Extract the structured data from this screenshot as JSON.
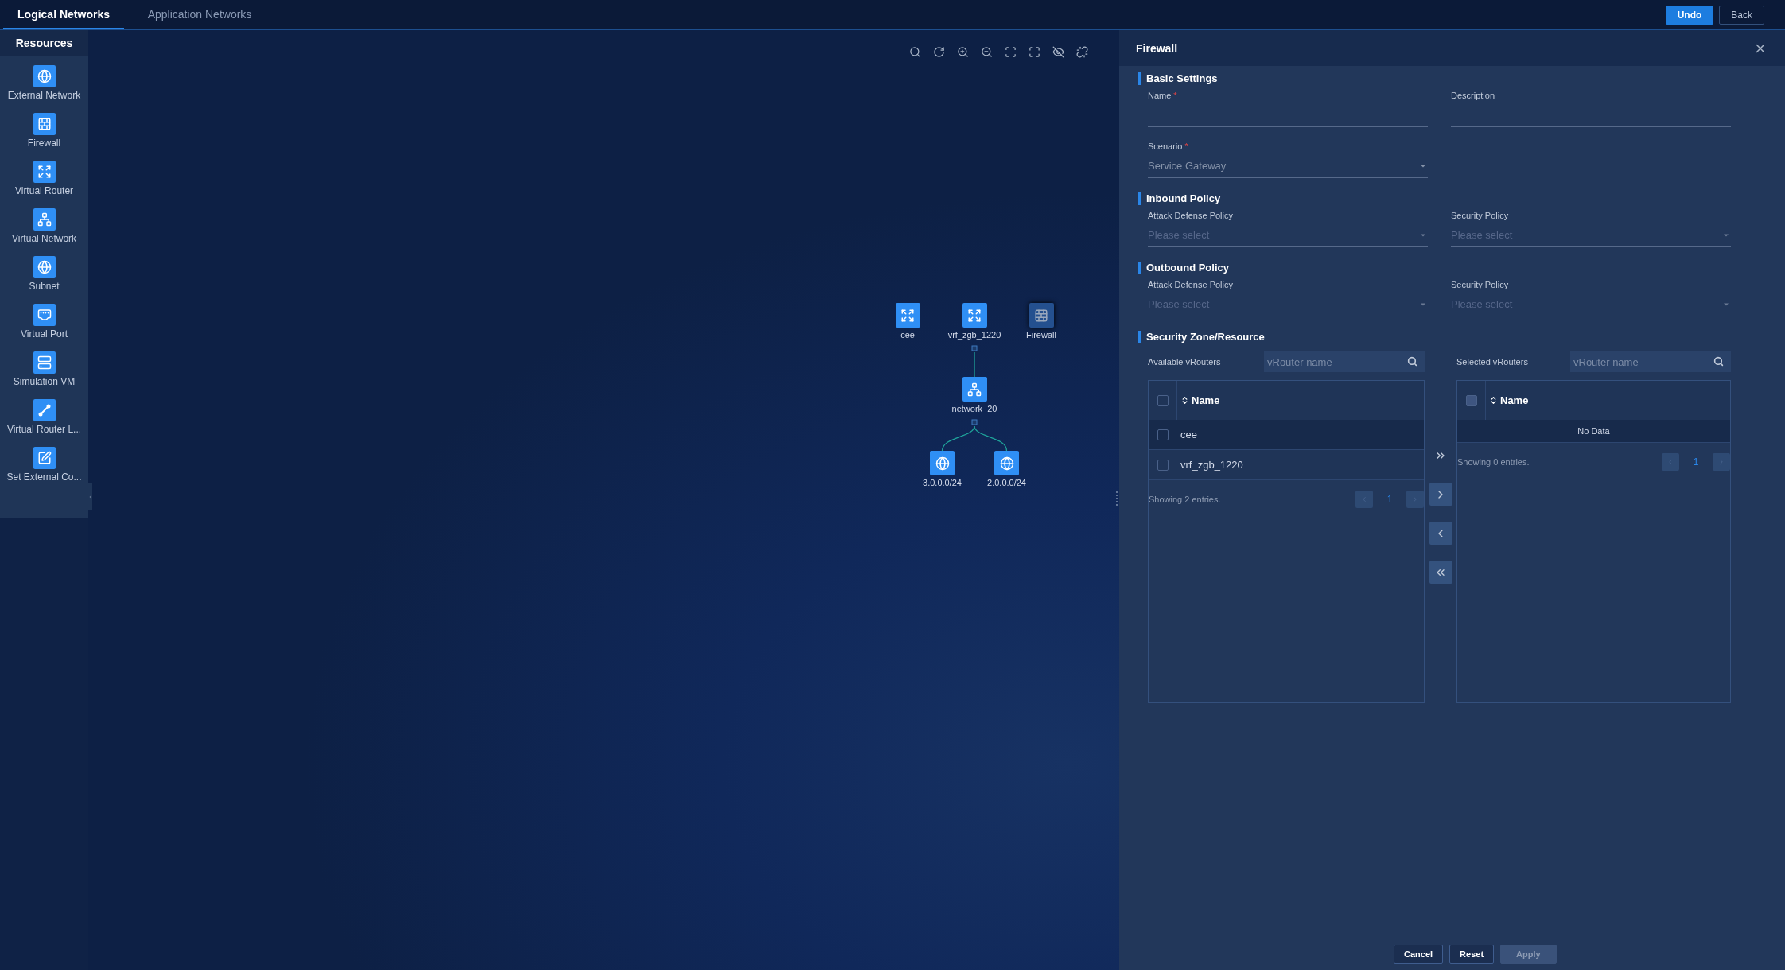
{
  "top_tabs": [
    {
      "label": "Logical Networks",
      "selected": true
    },
    {
      "label": "Application Networks",
      "selected": false
    }
  ],
  "top_actions": [
    {
      "label": "Undo",
      "kind": "primary"
    },
    {
      "label": "Back",
      "kind": "secondary"
    }
  ],
  "sidebar": {
    "title": "Resources",
    "items": [
      {
        "label": "External Network",
        "kind": "external"
      },
      {
        "label": "Firewall",
        "kind": "firewall"
      },
      {
        "label": "Virtual Router",
        "kind": "router"
      },
      {
        "label": "Virtual Network",
        "kind": "network"
      },
      {
        "label": "Subnet",
        "kind": "subnet"
      },
      {
        "label": "Virtual Port",
        "kind": "port"
      },
      {
        "label": "Simulation VM",
        "kind": "vm"
      },
      {
        "label": "Virtual Router L...",
        "kind": "link"
      },
      {
        "label": "Set External Co...",
        "kind": "setexternal"
      }
    ]
  },
  "topology": {
    "nodes": [
      {
        "label": "cee",
        "kind": "router",
        "selected": false
      },
      {
        "label": "vrf_zgb_1220",
        "kind": "router",
        "selected": false,
        "children": [
          {
            "label": "network_20",
            "kind": "network",
            "selected": false,
            "children": [
              {
                "label": "3.0.0.0/24",
                "kind": "subnet",
                "selected": false
              },
              {
                "label": "2.0.0.0/24",
                "kind": "subnet",
                "selected": false
              }
            ]
          }
        ]
      },
      {
        "label": "Firewall",
        "kind": "firewall",
        "selected": true
      }
    ]
  },
  "panel": {
    "title": "Firewall",
    "sections": [
      {
        "title": "Basic Settings",
        "fields": [
          {
            "label": "Name",
            "kind": "input",
            "required_mark": "*"
          },
          {
            "label": "Description",
            "kind": "input"
          },
          {
            "label": "Scenario",
            "kind": "select",
            "required_mark": "*",
            "value": "Service Gateway",
            "disabled": true
          }
        ]
      },
      {
        "title": "Inbound Policy",
        "fields": [
          {
            "label": "Attack Defense Policy",
            "kind": "select",
            "placeholder": "Please select",
            "disabled": false
          },
          {
            "label": "Security Policy",
            "kind": "select",
            "placeholder": "Please select",
            "disabled": false
          }
        ]
      },
      {
        "title": "Outbound Policy",
        "fields": [
          {
            "label": "Attack Defense Policy",
            "kind": "select",
            "placeholder": "Please select",
            "disabled": false
          },
          {
            "label": "Security Policy",
            "kind": "select",
            "placeholder": "Please select",
            "disabled": false
          }
        ]
      }
    ],
    "transfer": {
      "title": "Security Zone/Resource",
      "lists": [
        {
          "label": "Available vRouters",
          "search_placeholder": "vRouter name",
          "column": "Name",
          "header_checkbox_disabled": false,
          "rows": [
            {
              "name": "cee",
              "checked": false,
              "hovered": true
            },
            {
              "name": "vrf_zgb_1220",
              "checked": false,
              "hovered": false
            }
          ],
          "summary": "Showing 2 entries.",
          "page": "1"
        },
        {
          "label": "Selected vRouters",
          "search_placeholder": "vRouter name",
          "column": "Name",
          "header_checkbox_disabled": true,
          "empty_text": "No Data",
          "summary": "Showing 0 entries.",
          "page": "1"
        }
      ],
      "buttons": [
        {
          "kind": "all-right",
          "disabled": true
        },
        {
          "kind": "right",
          "disabled": false
        },
        {
          "kind": "left",
          "disabled": false
        },
        {
          "kind": "all-left",
          "disabled": false
        }
      ]
    },
    "footer_buttons": [
      {
        "label": "Cancel",
        "disabled": false
      },
      {
        "label": "Reset",
        "disabled": false
      },
      {
        "label": "Apply",
        "disabled": true
      }
    ]
  }
}
